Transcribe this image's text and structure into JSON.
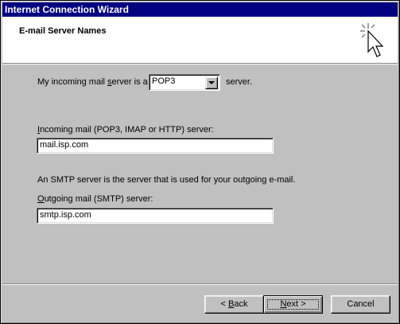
{
  "window": {
    "title": "Internet Connection Wizard"
  },
  "header": {
    "title": "E-mail Server Names",
    "icon": "wizard-cursor-icon"
  },
  "incoming_type": {
    "label_pre": "My incoming mail ",
    "label_access": "s",
    "label_post": "erver is a",
    "selected": "POP3",
    "suffix": "server."
  },
  "incoming_server": {
    "label_access": "I",
    "label_rest": "ncoming mail (POP3, IMAP or HTTP) server:",
    "value": "mail.isp.com"
  },
  "smtp_info": "An SMTP server is the server that is used for your outgoing e-mail.",
  "outgoing_server": {
    "label_access": "O",
    "label_rest": "utgoing mail (SMTP) server:",
    "value": "smtp.isp.com"
  },
  "buttons": {
    "back_prefix": "< ",
    "back_access": "B",
    "back_rest": "ack",
    "next_access": "N",
    "next_rest": "ext >",
    "cancel": "Cancel"
  }
}
